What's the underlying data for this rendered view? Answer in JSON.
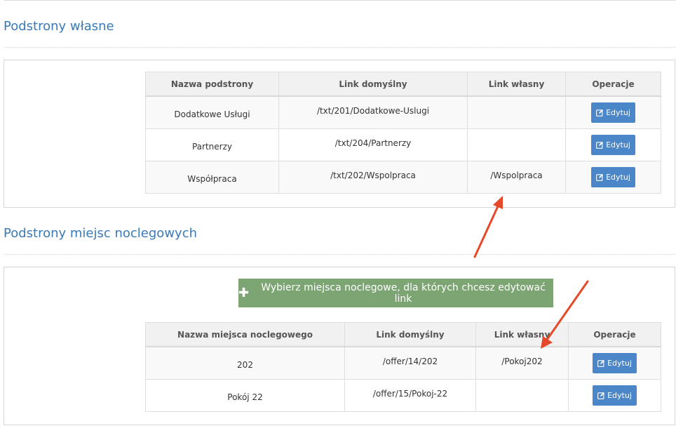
{
  "own_pages": {
    "title": "Podstrony własne",
    "columns": [
      "Nazwa podstrony",
      "Link domyślny",
      "Link własny",
      "Operacje"
    ],
    "rows": [
      {
        "name": "Dodatkowe Usługi",
        "default_link": "/txt/201/Dodatkowe-Uslugi",
        "own_link": "",
        "action": "Edytuj"
      },
      {
        "name": "Partnerzy",
        "default_link": "/txt/204/Partnerzy",
        "own_link": "",
        "action": "Edytuj"
      },
      {
        "name": "Współpraca",
        "default_link": "/txt/202/Wspolpraca",
        "own_link": "/Wspolpraca",
        "action": "Edytuj"
      }
    ]
  },
  "accommodation_pages": {
    "title": "Podstrony miejsc noclegowych",
    "choose_button": "Wybierz miejsca noclegowe, dla których chcesz edytować link",
    "columns": [
      "Nazwa miejsca noclegowego",
      "Link domyślny",
      "Link własny",
      "Operacje"
    ],
    "rows": [
      {
        "name": "202",
        "default_link": "/offer/14/202",
        "own_link": "/Pokoj202",
        "action": "Edytuj"
      },
      {
        "name": "Pokój 22",
        "default_link": "/offer/15/Pokoj-22",
        "own_link": "",
        "action": "Edytuj"
      }
    ]
  },
  "colors": {
    "title_blue": "#3a7ab8",
    "edit_button": "#4a86c8",
    "green_button": "#7da574",
    "annotation_arrow": "#e5492a"
  },
  "icons": {
    "edit": "pencil-square-icon",
    "plus": "plus-icon"
  }
}
